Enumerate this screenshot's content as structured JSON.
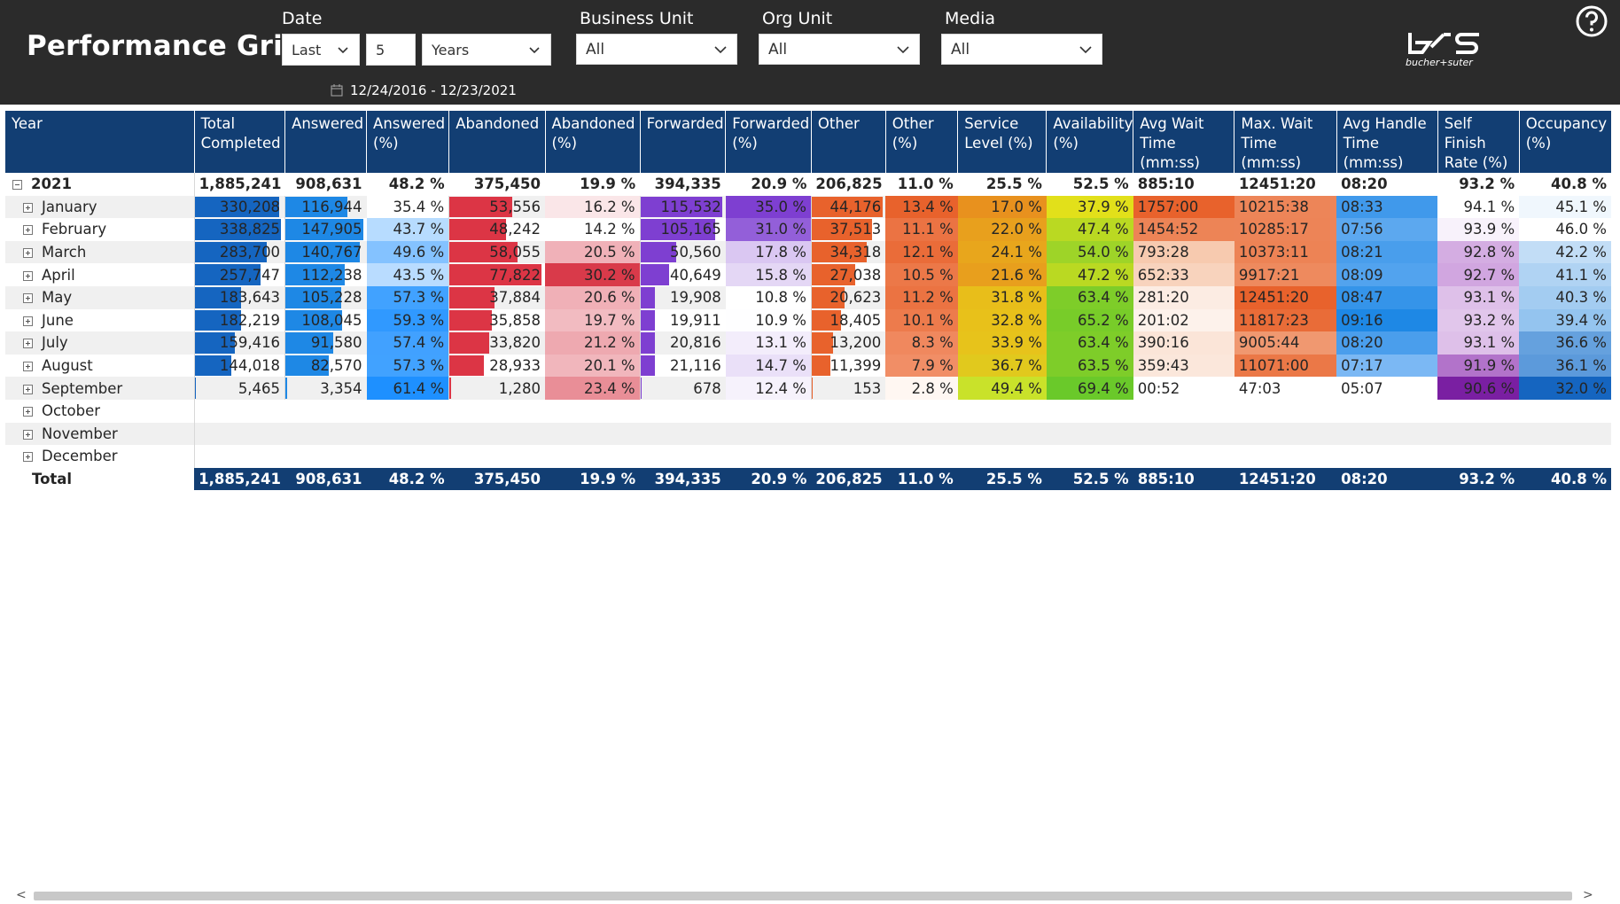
{
  "header": {
    "title": "Performance Grid",
    "filters": {
      "date_label": "Date",
      "date_mode": "Last",
      "date_count": "5",
      "date_unit": "Years",
      "date_range": "12/24/2016 - 12/23/2021",
      "business_unit_label": "Business Unit",
      "business_unit_value": "All",
      "org_unit_label": "Org Unit",
      "org_unit_value": "All",
      "media_label": "Media",
      "media_value": "All"
    },
    "logo_text": "bucher+suter",
    "help_icon": "question-circle-icon"
  },
  "grid": {
    "columns": [
      "Year",
      "Total Completed",
      "Answered",
      "Answered (%)",
      "Abandoned",
      "Abandoned (%)",
      "Forwarded",
      "Forwarded (%)",
      "Other",
      "Other (%)",
      "Service Level (%)",
      "Availability (%)",
      "Avg Wait Time (mm:ss)",
      "Max. Wait Time (mm:ss)",
      "Avg Handle Time (mm:ss)",
      "Self Finish Rate (%)",
      "Occupancy (%)"
    ],
    "year_row": {
      "label": "2021",
      "cells": [
        "1,885,241",
        "908,631",
        "48.2 %",
        "375,450",
        "19.9 %",
        "394,335",
        "20.9 %",
        "206,825",
        "11.0 %",
        "25.5 %",
        "52.5 %",
        "885:10",
        "12451:20",
        "08:20",
        "93.2 %",
        "40.8 %"
      ]
    },
    "rows": [
      {
        "label": "January",
        "cells": [
          "330,208",
          "116,944",
          "35.4 %",
          "53,556",
          "16.2 %",
          "115,532",
          "35.0 %",
          "44,176",
          "13.4 %",
          "17.0 %",
          "37.9 %",
          "1757:00",
          "10215:38",
          "08:33",
          "94.1 %",
          "45.1 %"
        ]
      },
      {
        "label": "February",
        "cells": [
          "338,825",
          "147,905",
          "43.7 %",
          "48,242",
          "14.2 %",
          "105,165",
          "31.0 %",
          "37,513",
          "11.1 %",
          "22.0 %",
          "47.4 %",
          "1454:52",
          "10285:17",
          "07:56",
          "93.9 %",
          "46.0 %"
        ]
      },
      {
        "label": "March",
        "cells": [
          "283,700",
          "140,767",
          "49.6 %",
          "58,055",
          "20.5 %",
          "50,560",
          "17.8 %",
          "34,318",
          "12.1 %",
          "24.1 %",
          "54.0 %",
          "793:28",
          "10373:11",
          "08:21",
          "92.8 %",
          "42.2 %"
        ]
      },
      {
        "label": "April",
        "cells": [
          "257,747",
          "112,238",
          "43.5 %",
          "77,822",
          "30.2 %",
          "40,649",
          "15.8 %",
          "27,038",
          "10.5 %",
          "21.6 %",
          "47.2 %",
          "652:33",
          "9917:21",
          "08:09",
          "92.7 %",
          "41.1 %"
        ]
      },
      {
        "label": "May",
        "cells": [
          "183,643",
          "105,228",
          "57.3 %",
          "37,884",
          "20.6 %",
          "19,908",
          "10.8 %",
          "20,623",
          "11.2 %",
          "31.8 %",
          "63.4 %",
          "281:20",
          "12451:20",
          "08:47",
          "93.1 %",
          "40.3 %"
        ]
      },
      {
        "label": "June",
        "cells": [
          "182,219",
          "108,045",
          "59.3 %",
          "35,858",
          "19.7 %",
          "19,911",
          "10.9 %",
          "18,405",
          "10.1 %",
          "32.8 %",
          "65.2 %",
          "201:02",
          "11817:23",
          "09:16",
          "93.2 %",
          "39.4 %"
        ]
      },
      {
        "label": "July",
        "cells": [
          "159,416",
          "91,580",
          "57.4 %",
          "33,820",
          "21.2 %",
          "20,816",
          "13.1 %",
          "13,200",
          "8.3 %",
          "33.9 %",
          "63.4 %",
          "390:16",
          "9005:44",
          "08:20",
          "93.1 %",
          "36.6 %"
        ]
      },
      {
        "label": "August",
        "cells": [
          "144,018",
          "82,570",
          "57.3 %",
          "28,933",
          "20.1 %",
          "21,116",
          "14.7 %",
          "11,399",
          "7.9 %",
          "36.7 %",
          "63.5 %",
          "359:43",
          "11071:00",
          "07:17",
          "91.9 %",
          "36.1 %"
        ]
      },
      {
        "label": "September",
        "cells": [
          "5,465",
          "3,354",
          "61.4 %",
          "1,280",
          "23.4 %",
          "678",
          "12.4 %",
          "153",
          "2.8 %",
          "49.4 %",
          "69.4 %",
          "00:52",
          "47:03",
          "05:07",
          "90.6 %",
          "32.0 %"
        ]
      },
      {
        "label": "October",
        "cells": []
      },
      {
        "label": "November",
        "cells": []
      },
      {
        "label": "December",
        "cells": []
      }
    ],
    "total_row": {
      "label": "Total",
      "cells": [
        "1,885,241",
        "908,631",
        "48.2 %",
        "375,450",
        "19.9 %",
        "394,335",
        "20.9 %",
        "206,825",
        "11.0 %",
        "25.5 %",
        "52.5 %",
        "885:10",
        "12451:20",
        "08:20",
        "93.2 %",
        "40.8 %"
      ]
    }
  },
  "colors": {
    "header_bg": "#2b2b2b",
    "table_header_bg": "#123e73",
    "total_completed_bar": "#1565c0",
    "answered_bar": "#1e88e5",
    "abandoned_bar": "#dc3545",
    "forwarded_bar": "#7e3fd1",
    "other_bar": "#e8622c"
  }
}
